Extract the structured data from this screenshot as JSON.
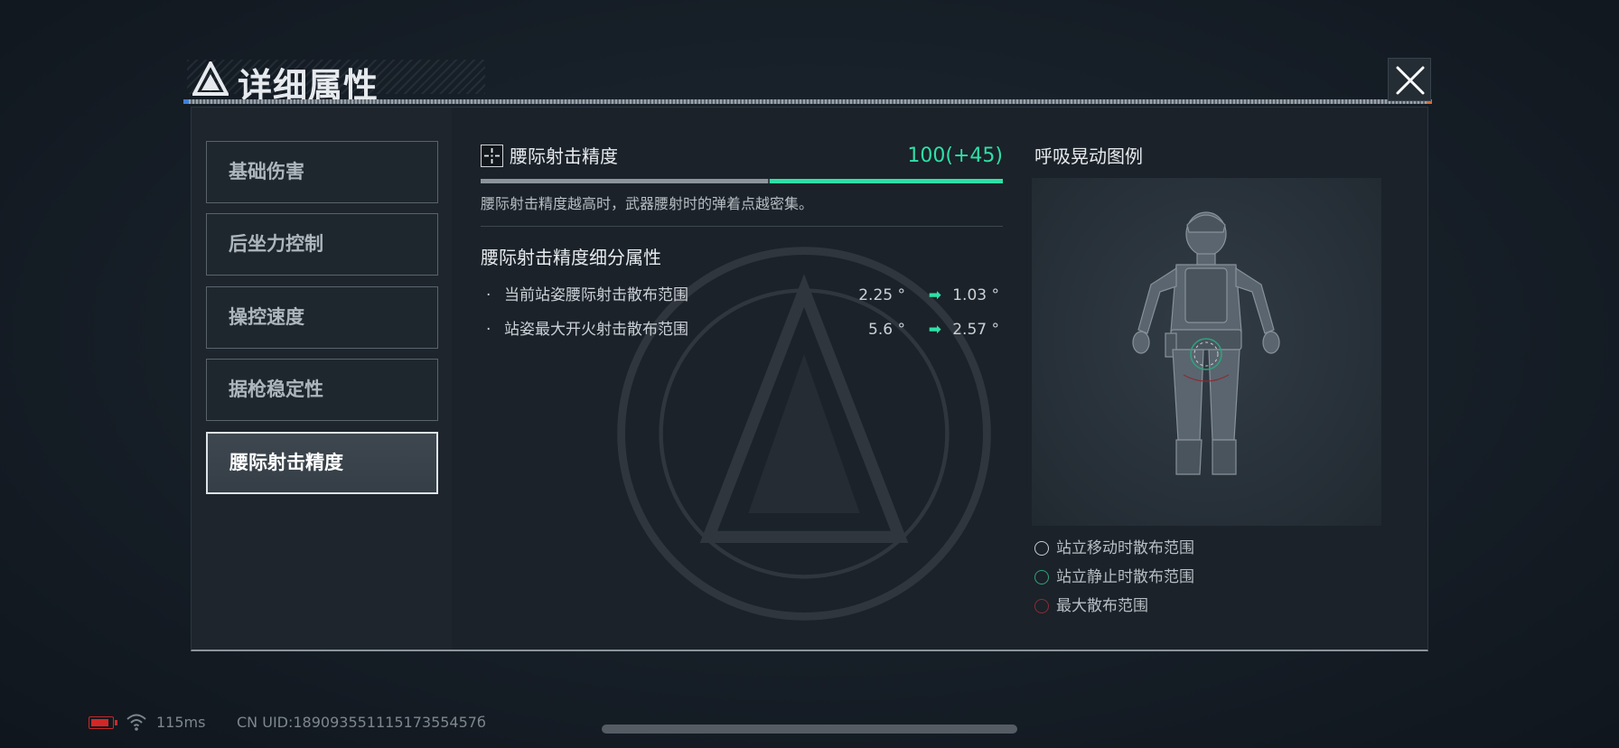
{
  "title": "详细属性",
  "close_icon": "close-x-icon",
  "sidebar": {
    "items": [
      {
        "label": "基础伤害",
        "active": false
      },
      {
        "label": "后坐力控制",
        "active": false
      },
      {
        "label": "操控速度",
        "active": false
      },
      {
        "label": "据枪稳定性",
        "active": false
      },
      {
        "label": "腰际射击精度",
        "active": true
      }
    ]
  },
  "stat": {
    "icon": "crosshair-icon",
    "name": "腰际射击精度",
    "value": "100(+45)",
    "bar_base_fraction": 0.55,
    "bar_total_fraction": 1.0,
    "description": "腰际射击精度越高时，武器腰射时的弹着点越密集。"
  },
  "sub": {
    "title": "腰际射击精度细分属性",
    "rows": [
      {
        "bullet": "·",
        "label": "当前站姿腰际射击散布范围",
        "before": "2.25 °",
        "arrow": "➡",
        "after": "1.03 °"
      },
      {
        "bullet": "·",
        "label": "站姿最大开火射击散布范围",
        "before": "5.6 °",
        "arrow": "➡",
        "after": "2.57 °"
      }
    ]
  },
  "preview": {
    "title": "呼吸晃动图例",
    "legend": [
      {
        "label": "站立移动时散布范围",
        "color": "#c8ced3"
      },
      {
        "label": "站立静止时散布范围",
        "color": "#2fa37d"
      },
      {
        "label": "最大散布范围",
        "color": "#8a2d33"
      }
    ]
  },
  "status": {
    "ping": "115ms",
    "uid": "CN UID:18909355111517355457б",
    "battery_level": 0.9
  },
  "colors": {
    "accent": "#2ee0a6",
    "battery": "#d22727"
  }
}
